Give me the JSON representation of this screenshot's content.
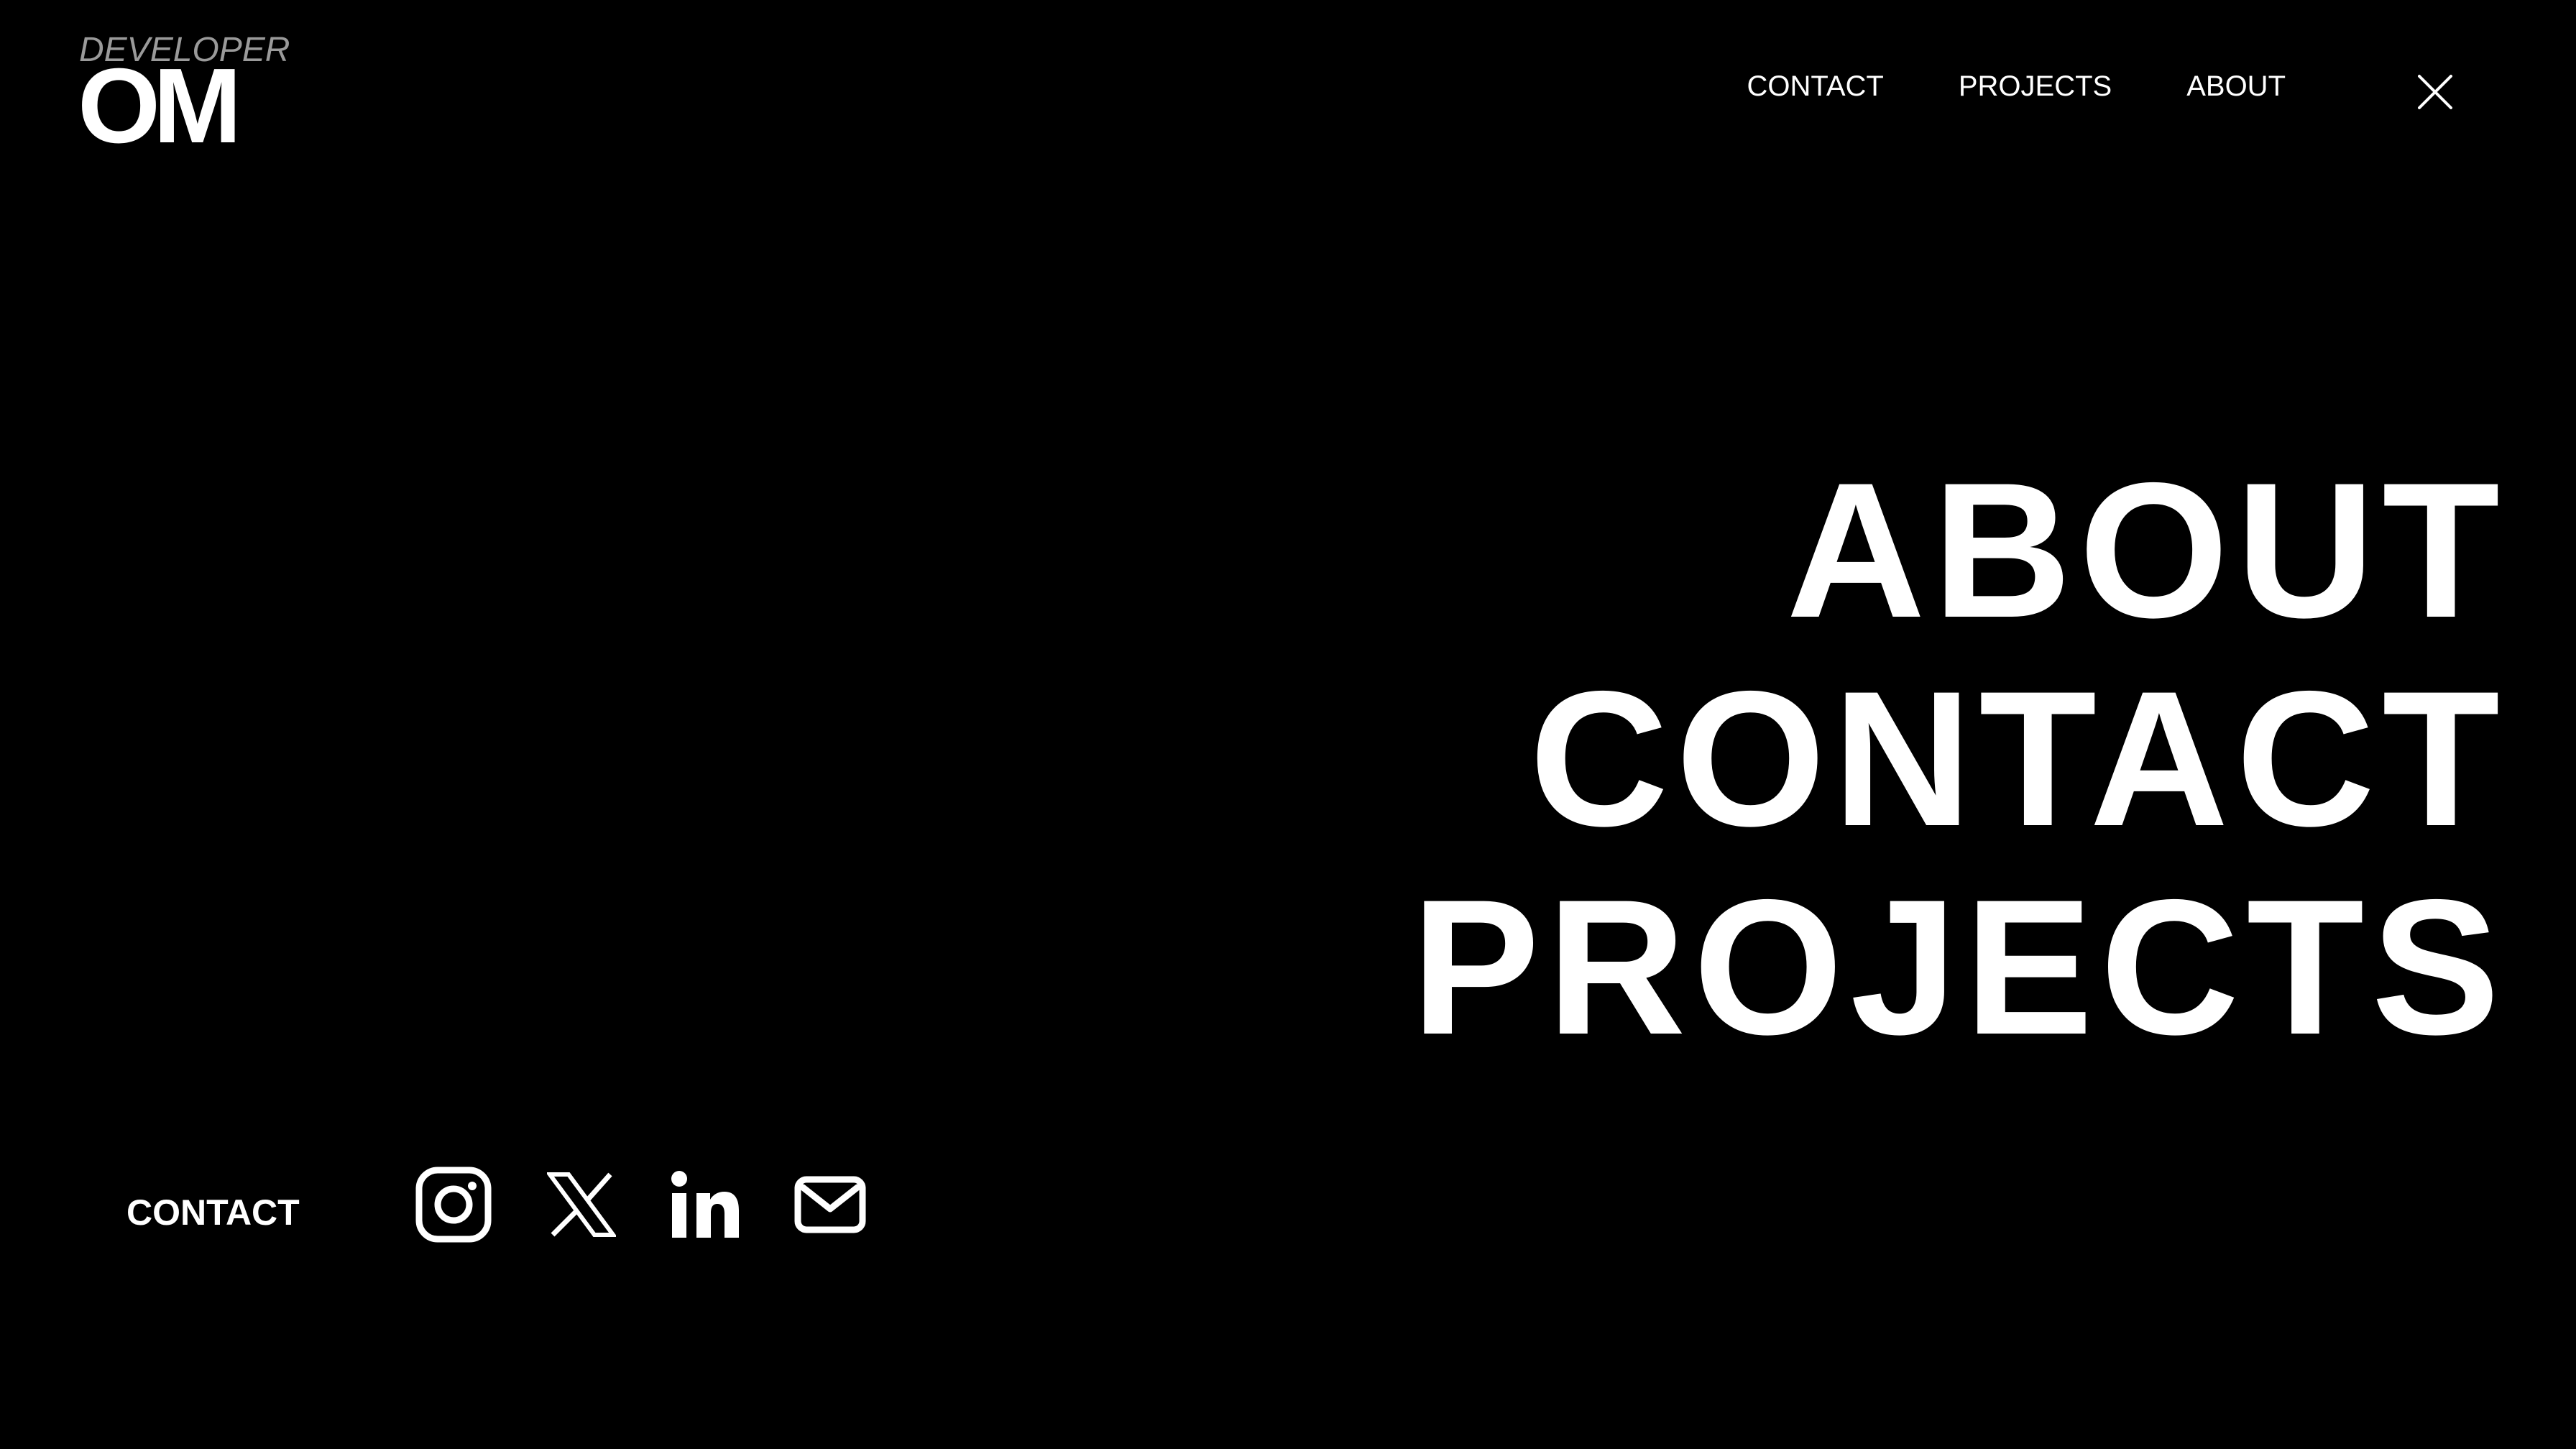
{
  "logo": {
    "subtitle": "DEVELOPER",
    "name": "OM"
  },
  "top_nav": {
    "items": [
      {
        "label": "CONTACT"
      },
      {
        "label": "PROJECTS"
      },
      {
        "label": "ABOUT"
      }
    ],
    "close_icon": "close-icon"
  },
  "menu": {
    "items": [
      {
        "label": "ABOUT"
      },
      {
        "label": "CONTACT"
      },
      {
        "label": "PROJECTS"
      }
    ]
  },
  "contact": {
    "label": "CONTACT",
    "social_icons": [
      "instagram-icon",
      "x-icon",
      "linkedin-icon",
      "email-icon"
    ]
  },
  "colors": {
    "background": "#000000",
    "text": "#ffffff",
    "logo_subtitle": "#9a9a9a"
  }
}
